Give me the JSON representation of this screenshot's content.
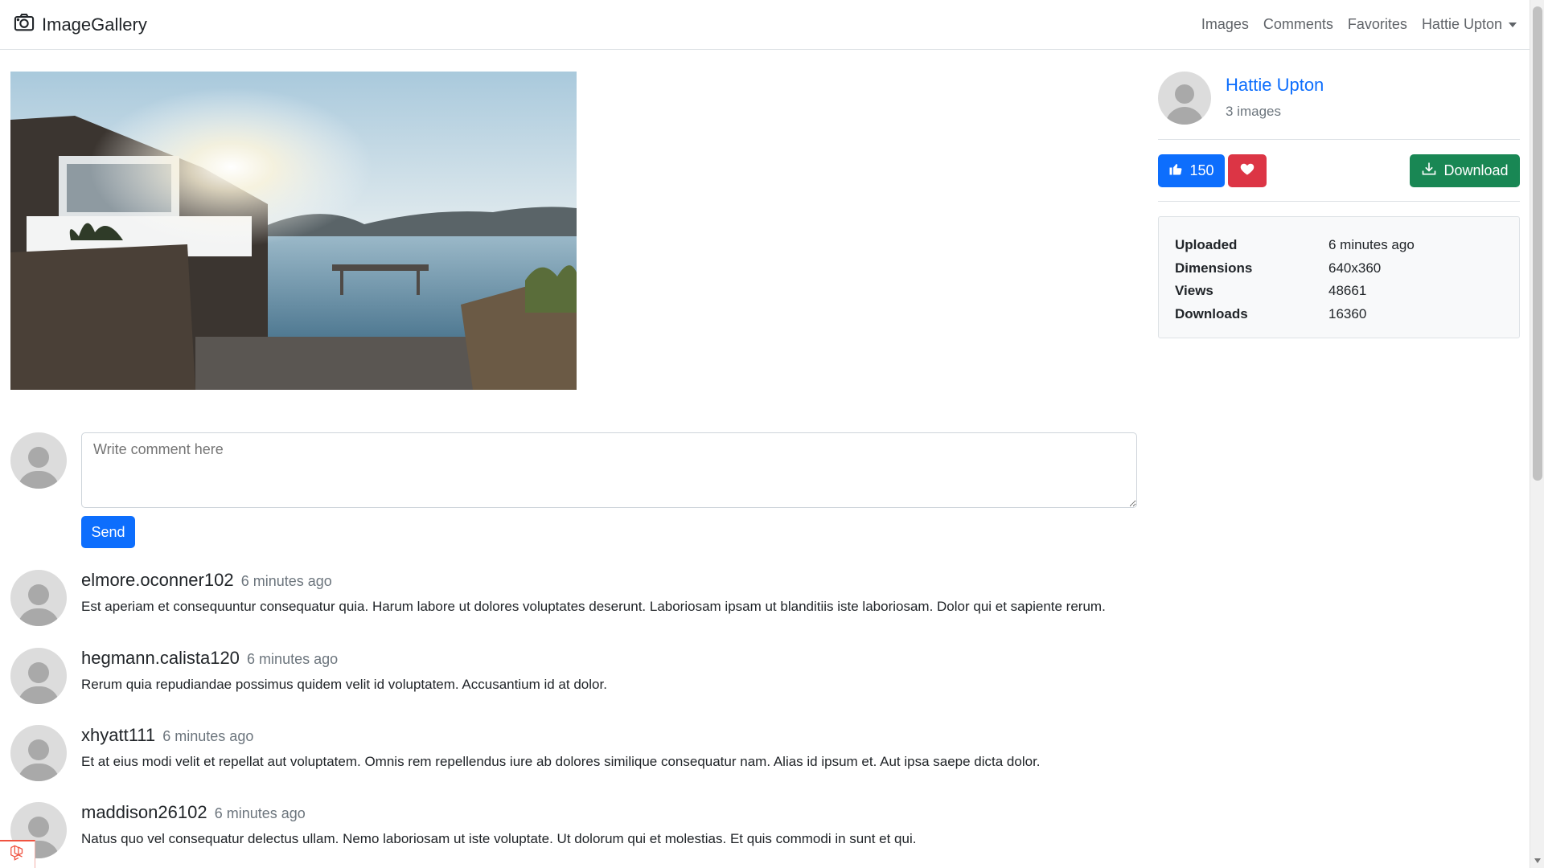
{
  "nav": {
    "brand": "ImageGallery",
    "links": [
      "Images",
      "Comments",
      "Favorites"
    ],
    "user": "Hattie Upton"
  },
  "owner": {
    "name": "Hattie Upton",
    "image_count": "3 images"
  },
  "actions": {
    "likes": "150",
    "download_label": "Download"
  },
  "stats": [
    {
      "label": "Uploaded",
      "value": "6 minutes ago"
    },
    {
      "label": "Dimensions",
      "value": "640x360"
    },
    {
      "label": "Views",
      "value": "48661"
    },
    {
      "label": "Downloads",
      "value": "16360"
    }
  ],
  "comment_form": {
    "placeholder": "Write comment here",
    "send_label": "Send"
  },
  "comments": [
    {
      "user": "elmore.oconner102",
      "time": "6 minutes ago",
      "text": "Est aperiam et consequuntur consequatur quia. Harum labore ut dolores voluptates deserunt. Laboriosam ipsam ut blanditiis iste laboriosam. Dolor qui et sapiente rerum."
    },
    {
      "user": "hegmann.calista120",
      "time": "6 minutes ago",
      "text": "Rerum quia repudiandae possimus quidem velit id voluptatem. Accusantium id at dolor."
    },
    {
      "user": "xhyatt111",
      "time": "6 minutes ago",
      "text": "Et at eius modi velit et repellat aut voluptatem. Omnis rem repellendus iure ab dolores similique consequatur nam. Alias id ipsum et. Aut ipsa saepe dicta dolor."
    },
    {
      "user": "maddison26102",
      "time": "6 minutes ago",
      "text": "Natus quo vel consequatur delectus ullam. Nemo laboriosam ut iste voluptate. Ut dolorum qui et molestias. Et quis commodi in sunt et qui."
    }
  ],
  "colors": {
    "primary": "#0d6efd",
    "danger": "#dc3545",
    "success": "#198754",
    "muted": "#6c757d"
  },
  "icons": {
    "brand": "camera-icon",
    "like": "thumbs-up-icon",
    "favorite": "heart-icon",
    "download": "download-icon"
  }
}
